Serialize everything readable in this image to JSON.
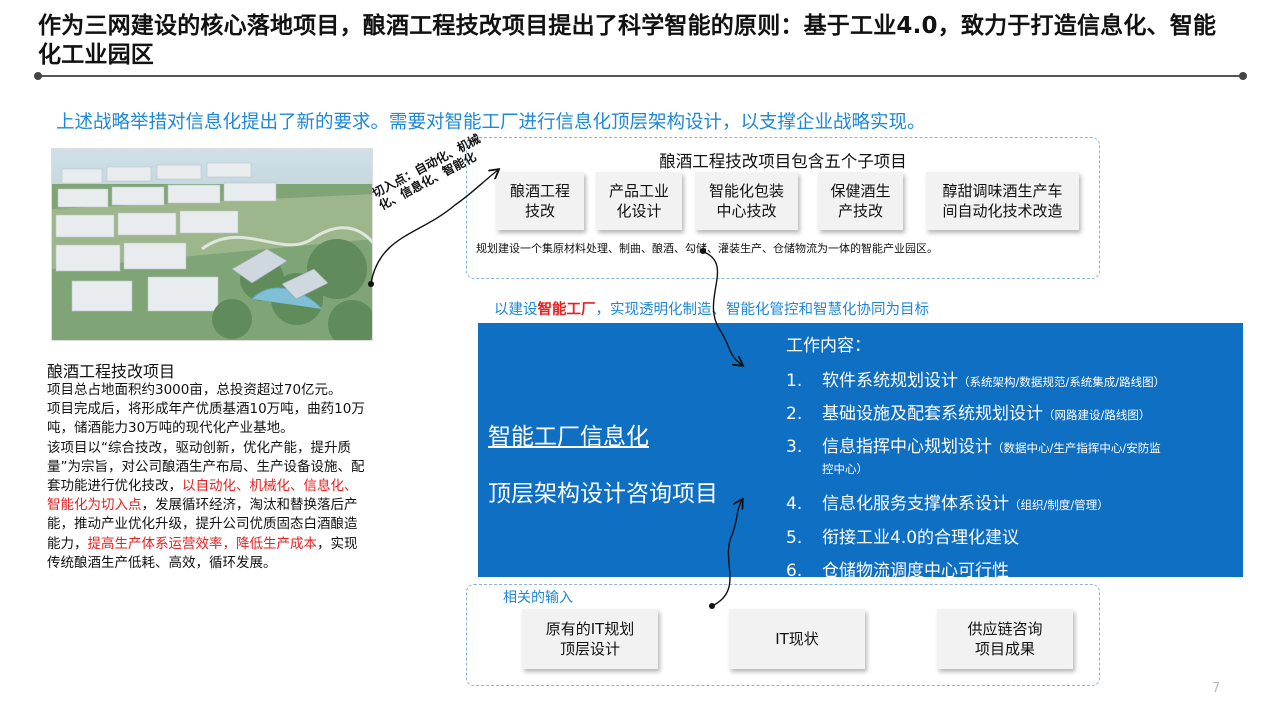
{
  "slide": {
    "title": "作为三网建设的核心落地项目，酿酒工程技改项目提出了科学智能的原则：基于工业4.0，致力于打造信息化、智能化工业园区",
    "subtitle": "上述战略举措对信息化提出了新的要求。需要对智能工厂进行信息化顶层架构设计，以支撑企业战略实现。",
    "page_number": "7"
  },
  "photo": {
    "callout": "切入点：自动化、机械化、信息化、智能化"
  },
  "project": {
    "title": "酿酒工程技改项目",
    "para1": "项目总占地面积约3000亩，总投资超过70亿元。",
    "para2": "项目完成后，将形成年产优质基酒10万吨，曲药10万吨，储酒能力30万吨的现代化产业基地。",
    "para3_a": "该项目以“综合技改，驱动创新，优化产能，提升质量”为宗旨，对公司酿酒生产布局、生产设备设施、配套功能进行优化技改，",
    "para3_red1": "以自动化、机械化、信息化、智能化为切入点",
    "para3_b": "，发展循环经济，淘汰和替换落后产能，推动产业优化升级，提升公司优质固态白酒酿造能力，",
    "para3_red2": "提高生产体系运营效率，降低生产成本",
    "para3_c": "，实现传统酿酒生产低耗、高效，循环发展。"
  },
  "subprojects": {
    "title": "酿酒工程技改项目包含五个子项目",
    "items": [
      "酿酒工程\n技改",
      "产品工业\n化设计",
      "智能化包装\n中心技改",
      "保健酒生\n产技改",
      "醇甜调味酒生产车\n间自动化技术改造"
    ],
    "note": "规划建设一个集原材料处理、制曲、酿酒、勾储、灌装生产、仓储物流为一体的智能产业园区。"
  },
  "goal": {
    "prefix": "以建设",
    "highlight": "智能工厂",
    "suffix": "，实现透明化制造、智能化管控和智慧化协同为目标"
  },
  "consulting": {
    "title_line1": "智能工厂信息化",
    "title_line2": "顶层架构设计咨询项目",
    "work_heading": "工作内容：",
    "items": [
      {
        "num": "1.",
        "text": "软件系统规划设计",
        "note": "（系统架构/数据规范/系统集成/路线图）"
      },
      {
        "num": "2.",
        "text": "基础设施及配套系统规划设计",
        "note": "（网路建设/路线图）"
      },
      {
        "num": "3.",
        "text": "信息指挥中心规划设计",
        "note": "（数据中心/生产指挥中心/安防监"
      },
      {
        "num": "4.",
        "text": "信息化服务支撑体系设计",
        "note": "（组织/制度/管理）"
      },
      {
        "num": "5.",
        "text": "衔接工业4.0的合理化建议",
        "note": ""
      },
      {
        "num": "6.",
        "text": "仓储物流调度中心可行性",
        "note": ""
      }
    ],
    "item3_continuation": "控中心）"
  },
  "inputs": {
    "title": "相关的输入",
    "items": [
      "原有的IT规划\n顶层设计",
      "IT现状",
      "供应链咨询\n项目成果"
    ]
  },
  "colors": {
    "accent_blue": "#1e88d8",
    "panel_blue": "#0f6fc3",
    "highlight_red": "#e52020"
  }
}
